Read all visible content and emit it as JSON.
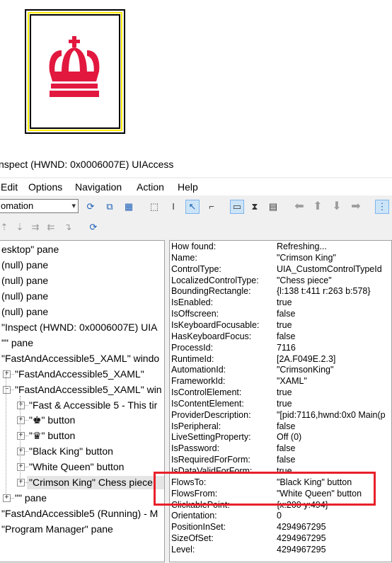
{
  "window": {
    "title": "nspect  (HWND: 0x0006007E) UIAccess"
  },
  "menu": [
    "Edit",
    "Options",
    "Navigation",
    "Action",
    "Help"
  ],
  "toolbar": {
    "mode_value": "omation"
  },
  "tree": [
    {
      "text": "esktop\" pane",
      "level": 0
    },
    {
      "text": "(null) pane",
      "level": 0
    },
    {
      "text": "(null) pane",
      "level": 0
    },
    {
      "text": "(null) pane",
      "level": 0
    },
    {
      "text": "(null) pane",
      "level": 0
    },
    {
      "text": "\"Inspect  (HWND: 0x0006007E) UIA",
      "level": 0
    },
    {
      "text": "\"\" pane",
      "level": 0
    },
    {
      "text": "\"FastAndAccessible5_XAML\" windo",
      "level": 0
    },
    {
      "text": "\"FastAndAccessible5_XAML\"",
      "level": 1,
      "expander": "+"
    },
    {
      "text": "\"FastAndAccessible5_XAML\" win",
      "level": 1,
      "expander": "−"
    },
    {
      "text": "\"Fast & Accessible 5 - This tir",
      "level": 2,
      "expander": "+"
    },
    {
      "text": "\"♚\" button",
      "level": 2,
      "expander": "+"
    },
    {
      "text": "\"♛\" button",
      "level": 2,
      "expander": "+"
    },
    {
      "text": "\"Black King\" button",
      "level": 2,
      "expander": "+"
    },
    {
      "text": "\"White Queen\" button",
      "level": 2,
      "expander": "+"
    },
    {
      "text": "\"Crimson King\" Chess piece",
      "level": 2,
      "expander": "+",
      "selected": true
    },
    {
      "text": "\"\" pane",
      "level": 1,
      "expander": "+"
    },
    {
      "text": "\"FastAndAccessible5 (Running) - M",
      "level": 0
    },
    {
      "text": "\"Program Manager\" pane",
      "level": 0
    }
  ],
  "properties": [
    {
      "name": "How found:",
      "value": "Refreshing..."
    },
    {
      "name": "Name:",
      "value": "\"Crimson King\""
    },
    {
      "name": "ControlType:",
      "value": "UIA_CustomControlTypeId"
    },
    {
      "name": "LocalizedControlType:",
      "value": "\"Chess piece\""
    },
    {
      "name": "BoundingRectangle:",
      "value": "{l:138 t:411 r:263 b:578}"
    },
    {
      "name": "IsEnabled:",
      "value": "true"
    },
    {
      "name": "IsOffscreen:",
      "value": "false"
    },
    {
      "name": "IsKeyboardFocusable:",
      "value": "true"
    },
    {
      "name": "HasKeyboardFocus:",
      "value": "false"
    },
    {
      "name": "ProcessId:",
      "value": "7116"
    },
    {
      "name": "RuntimeId:",
      "value": "[2A.F049E.2.3]"
    },
    {
      "name": "AutomationId:",
      "value": "\"CrimsonKing\""
    },
    {
      "name": "FrameworkId:",
      "value": "\"XAML\""
    },
    {
      "name": "IsControlElement:",
      "value": "true"
    },
    {
      "name": "IsContentElement:",
      "value": "true"
    },
    {
      "name": "ProviderDescription:",
      "value": "\"[pid:7116,hwnd:0x0 Main(p"
    },
    {
      "name": "IsPeripheral:",
      "value": "false"
    },
    {
      "name": "LiveSettingProperty:",
      "value": "Off (0)"
    },
    {
      "name": "IsPassword:",
      "value": "false"
    },
    {
      "name": "IsRequiredForForm:",
      "value": "false"
    },
    {
      "name": "IsDataValidForForm:",
      "value": "true"
    },
    {
      "name": "FlowsTo:",
      "value": "\"Black King\" button"
    },
    {
      "name": "FlowsFrom:",
      "value": "\"White Queen\" button"
    },
    {
      "name": "ClickablePoint:",
      "value": "{x:200 y:494}"
    },
    {
      "name": "Orientation:",
      "value": "0"
    },
    {
      "name": "PositionInSet:",
      "value": "4294967295"
    },
    {
      "name": "SizeOfSet:",
      "value": "4294967295"
    },
    {
      "name": "Level:",
      "value": "4294967295"
    }
  ],
  "colors": {
    "crown": "#e2183f",
    "highlight_border": "#e8202a",
    "tile_border": "#ffeb00"
  }
}
